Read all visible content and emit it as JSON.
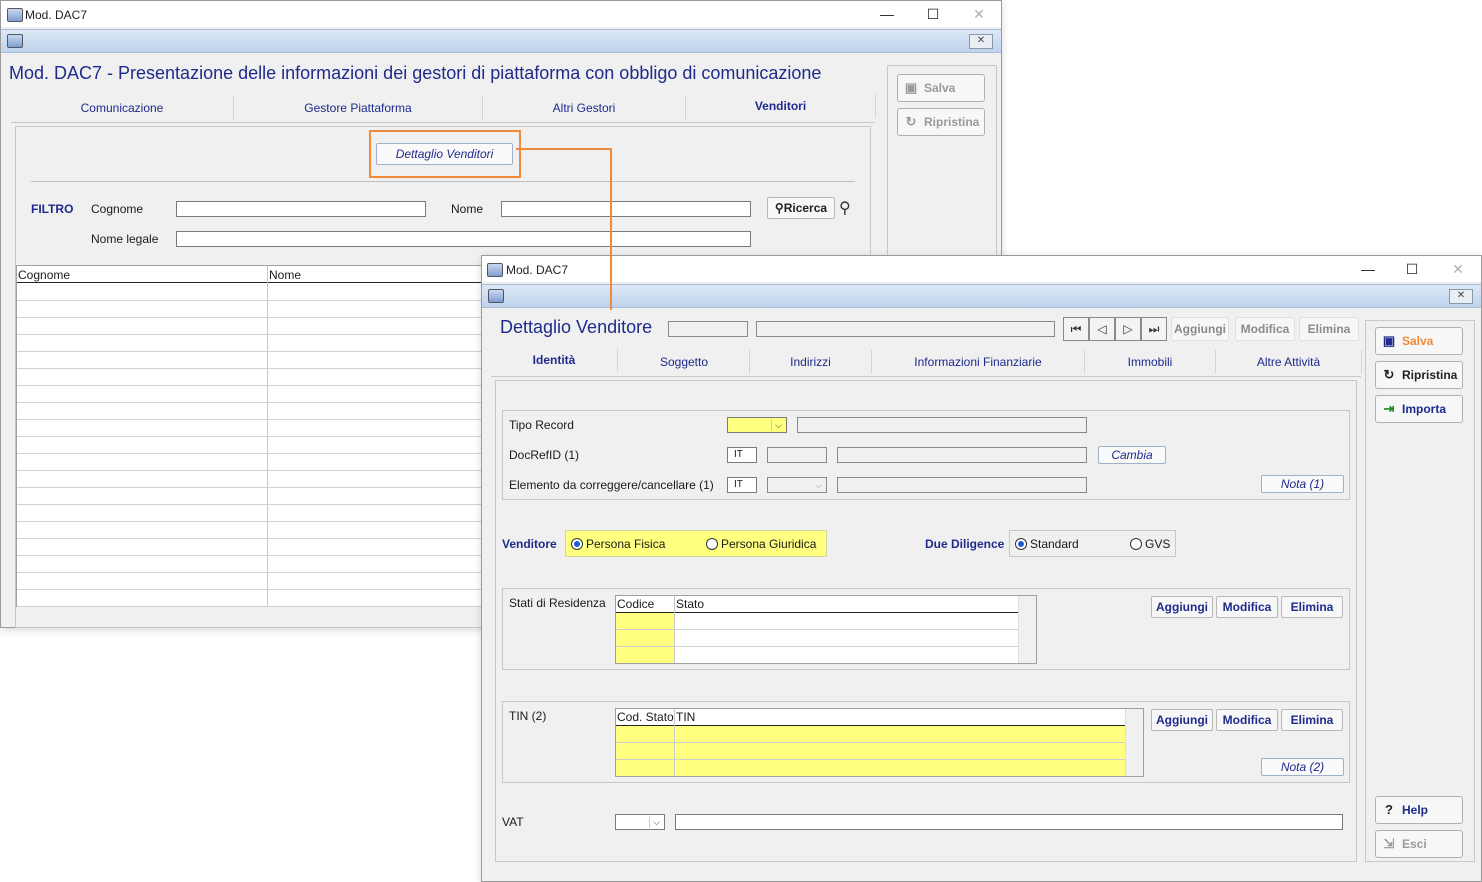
{
  "window1": {
    "title": "Mod. DAC7",
    "heading": "Mod. DAC7 - Presentazione delle informazioni dei gestori di piattaforma con obbligo di comunicazione",
    "tabs": [
      "Comunicazione",
      "Gestore Piattaforma",
      "Altri Gestori",
      "Venditori"
    ],
    "detail_button": "Dettaglio Venditori",
    "filter_label": "FILTRO",
    "cognome_label": "Cognome",
    "nome_label": "Nome",
    "nome_legale_label": "Nome legale",
    "search_button": "Ricerca",
    "grid_headers": [
      "Cognome",
      "Nome"
    ],
    "side_buttons": {
      "save": "Salva",
      "restore": "Ripristina"
    }
  },
  "window2": {
    "title": "Mod. DAC7",
    "heading": "Dettaglio Venditore",
    "nav_actions": [
      "Aggiungi",
      "Modifica",
      "Elimina"
    ],
    "tabs": [
      "Identità",
      "Soggetto",
      "Indirizzi",
      "Informazioni Finanziarie",
      "Immobili",
      "Altre Attività"
    ],
    "tipo_record_label": "Tipo Record",
    "docrefid_label": "DocRefID (1)",
    "docrefid_country": "IT",
    "cambia_button": "Cambia",
    "elemento_label": "Elemento da correggere/cancellare (1)",
    "elemento_country": "IT",
    "nota1_button": "Nota (1)",
    "venditore_label": "Venditore",
    "venditore_options": [
      "Persona Fisica",
      "Persona Giuridica"
    ],
    "due_diligence_label": "Due Diligence",
    "due_diligence_options": [
      "Standard",
      "GVS"
    ],
    "stati_label": "Stati di Residenza",
    "stati_headers": [
      "Codice",
      "Stato"
    ],
    "tin_label": "TIN (2)",
    "tin_headers": [
      "Cod. Stato",
      "TIN"
    ],
    "grid_actions": [
      "Aggiungi",
      "Modifica",
      "Elimina"
    ],
    "nota2_button": "Nota (2)",
    "vat_label": "VAT",
    "side_buttons": {
      "save": "Salva",
      "restore": "Ripristina",
      "import": "Importa",
      "help": "Help",
      "exit": "Esci"
    }
  },
  "colors": {
    "accent_orange": "#ee8a3a",
    "field_yellow": "#ffff80",
    "label_blue": "#1e2a8c"
  }
}
